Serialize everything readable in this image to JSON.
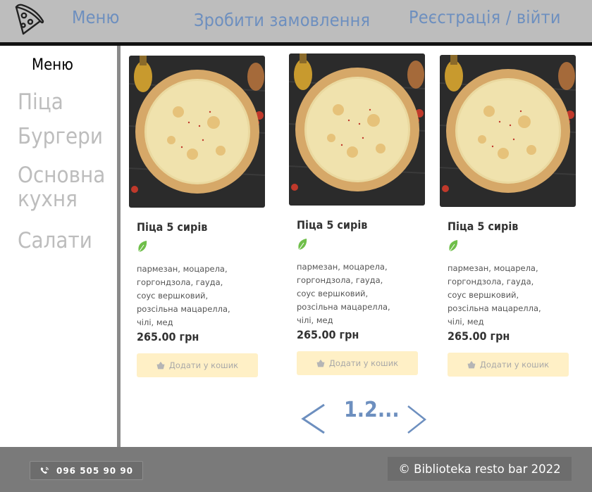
{
  "header": {
    "nav": [
      "Меню",
      "Зробити замовлення",
      "Реєстрація / війти"
    ],
    "logo_icon": "pizza-slice-icon"
  },
  "sidebar": {
    "title": "Меню",
    "items": [
      "Піца",
      "Бургери",
      "Основна кухня",
      "Салати"
    ]
  },
  "products": [
    {
      "name": "Піца 5 сирів",
      "description": "пармезан, моцарела, горгондзола, гауда, соус вершковий, розсільна мацарелла, чілі, мед",
      "price": "265.00 грн",
      "button": "Додати у кошик",
      "veg_icon": "leaf-icon"
    },
    {
      "name": "Піца 5 сирів",
      "description": "пармезан, моцарела, горгондзола, гауда, соус вершковий, розсільна мацарелла, чілі, мед",
      "price": "265.00 грн",
      "button": "Додати у кошик",
      "veg_icon": "leaf-icon"
    },
    {
      "name": "Піца 5 сирів",
      "description": "пармезан, моцарела, горгондзола, гауда, соус вершковий, розсільна мацарелла, чілі, мед",
      "price": "265.00 грн",
      "button": "Додати у кошик",
      "veg_icon": "leaf-icon"
    }
  ],
  "pagination": {
    "text": "1.2...",
    "prev_icon": "chevron-left-icon",
    "next_icon": "chevron-right-icon"
  },
  "footer": {
    "phone": "096 505 90 90",
    "copyright": "© Biblioteka resto bar 2022"
  },
  "colors": {
    "header_bg": "#bdbdbd",
    "nav_text": "#6d8fbf",
    "sidebar_text": "#bdbdbd",
    "button_bg": "#fff0c6",
    "leaf": "#6fbf4a",
    "footer_bg": "#7a7a7a"
  }
}
